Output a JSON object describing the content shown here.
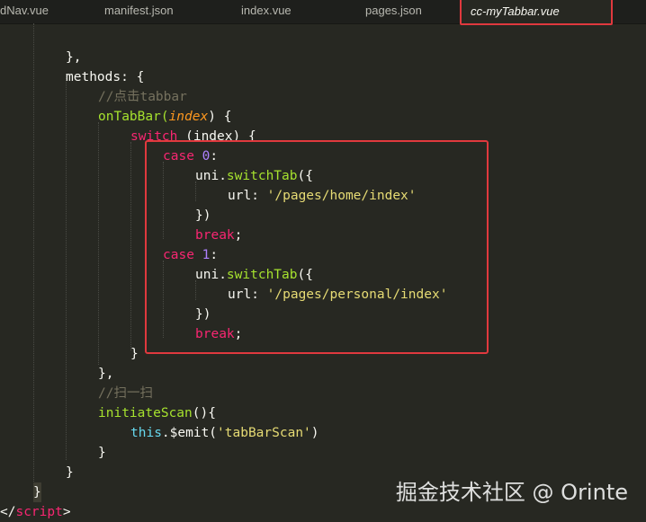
{
  "tabs": [
    {
      "label": "dNav.vue"
    },
    {
      "label": "manifest.json"
    },
    {
      "label": "index.vue"
    },
    {
      "label": "pages.json"
    },
    {
      "label": "cc-myTabbar.vue",
      "active": true
    }
  ],
  "code": {
    "l01": "},",
    "l02": "methods: {",
    "l03": "//点击tabbar",
    "l04_fn": "onTabBar(",
    "l04_param": "index",
    "l04_end": ") {",
    "l05_kw": "switch",
    "l05_rest": " (index) {",
    "l06_kw": "case",
    "l06_num": "0",
    "l06_end": ":",
    "l07_obj": "uni.",
    "l07_fn": "switchTab",
    "l07_end": "({",
    "l08_key": "url: ",
    "l08_str": "'/pages/home/index'",
    "l09": "})",
    "l10": "break",
    "l10_end": ";",
    "l11_kw": "case",
    "l11_num": "1",
    "l11_end": ":",
    "l12_obj": "uni.",
    "l12_fn": "switchTab",
    "l12_end": "({",
    "l13_key": "url: ",
    "l13_str": "'/pages/personal/index'",
    "l14": "})",
    "l15": "break",
    "l15_end": ";",
    "l16": "}",
    "l17": "},",
    "l18": "//扫一扫",
    "l19_fn": "initiateScan",
    "l19_end": "(){",
    "l20_this": "this",
    "l20_mid": ".$emit(",
    "l20_str": "'tabBarScan'",
    "l20_end": ")",
    "l21": "}",
    "l22": "}",
    "l23": "}",
    "l24_open": "</",
    "l24_tag": "script",
    "l24_close": ">"
  },
  "watermark": "掘金技术社区 @ Orinte",
  "colors": {
    "background": "#272822",
    "keyword": "#f92672",
    "function": "#a6e22e",
    "string": "#e6db74",
    "number": "#ae81ff",
    "comment": "#75715e",
    "highlight": "#e0393e"
  }
}
